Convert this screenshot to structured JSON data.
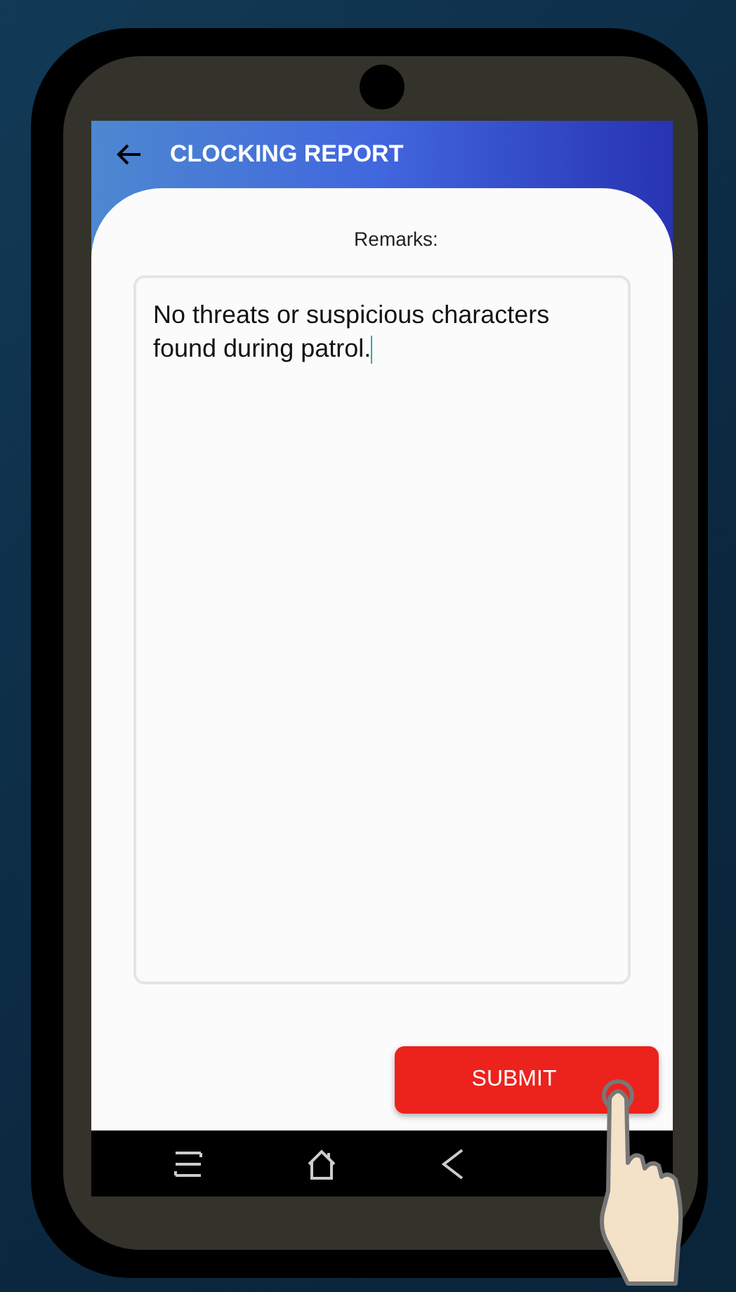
{
  "header": {
    "title": "CLOCKING REPORT"
  },
  "remarks": {
    "label": "Remarks:",
    "value": "No threats or suspicious characters found during patrol."
  },
  "buttons": [
    {
      "label": "SUBMIT"
    }
  ]
}
